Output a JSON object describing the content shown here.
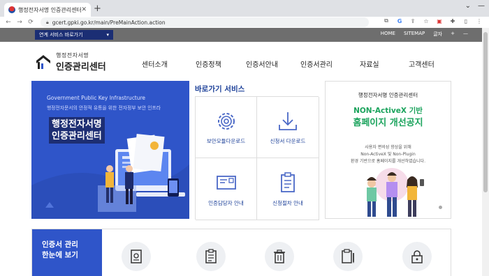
{
  "browser": {
    "tab_title": "행정전자서명 인증관리센터",
    "tab_close": "✕",
    "new_tab": "+",
    "url": "gcert.gpki.go.kr/main/PreMainAction.action",
    "window_controls": [
      "⌄",
      "—"
    ]
  },
  "utility": {
    "quick_select_label": "연계 서비스 바로가기",
    "links": [
      "HOME",
      "SITEMAP",
      "글자",
      "+",
      "—"
    ]
  },
  "logo": {
    "line1": "행정전자서명",
    "line2": "인증관리센터"
  },
  "gnb": [
    "센터소개",
    "인증정책",
    "인증서안내",
    "인증서관리",
    "자료실",
    "고객센터"
  ],
  "hero": {
    "english": "Government Public Key Infrastructure",
    "desc": "행정전자문서의 안정적 유통을 위한 전자정부 보안 인프라",
    "title_line1": "행정전자서명",
    "title_line2": "인증관리센터"
  },
  "quick": {
    "title": "바로가기 서비스",
    "items": [
      {
        "label": "보안모듈다운로드",
        "icon": "gear-icon"
      },
      {
        "label": "신청서 다운로드",
        "icon": "download-icon"
      },
      {
        "label": "인증담당자 안내",
        "icon": "mail-icon"
      },
      {
        "label": "신청절차 안내",
        "icon": "clipboard-icon"
      }
    ]
  },
  "notice": {
    "org": "행정전자서명 인증관리센터",
    "line1": "NON-ActiveX 기반",
    "line2": "홈페이지 개선공지",
    "body1": "사용자 편의성 향상을 위해",
    "body2": "Non-ActiveX 및 Non-Plugin",
    "body3": "환경 기반으로 홈페이지를 개선하였습니다."
  },
  "manage": {
    "line1": "인증서 관리",
    "line2": "한눈에 보기",
    "icons": [
      "certificate-icon",
      "checklist-icon",
      "trash-icon",
      "edit-clipboard-icon",
      "lock-icon"
    ]
  },
  "colors": {
    "brand_blue": "#2f55c9",
    "navy": "#1b2e74",
    "accent_green": "#1aa35c",
    "util_gray": "#6e6e6e"
  }
}
